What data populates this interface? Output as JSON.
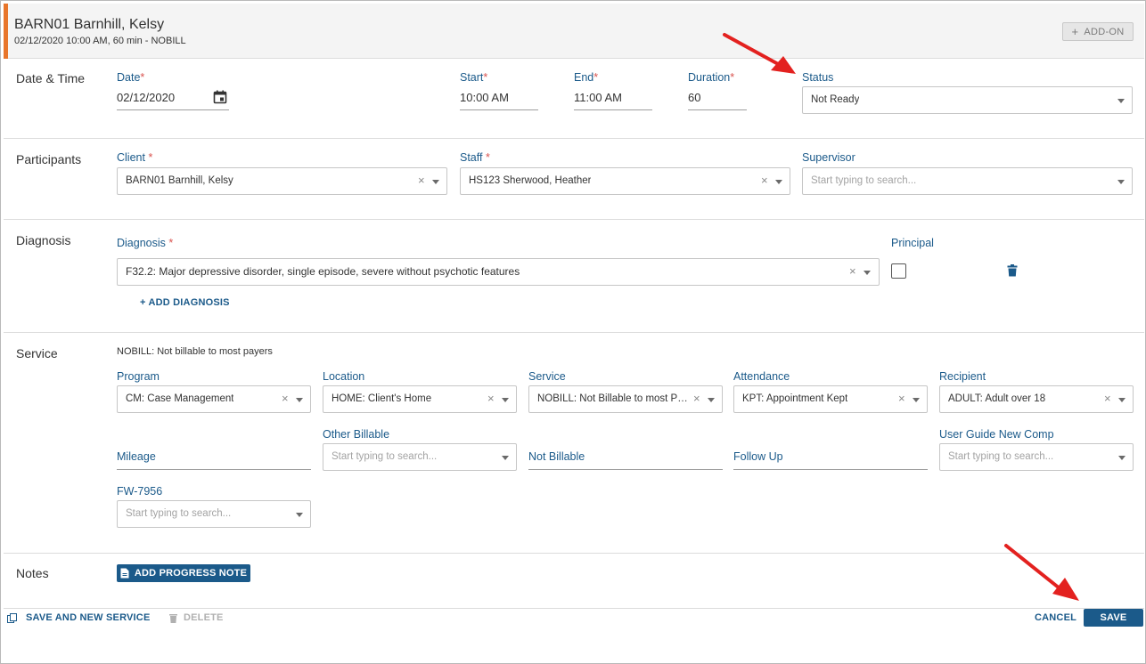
{
  "header": {
    "title": "BARN01 Barnhill, Kelsy",
    "subtitle": "02/12/2020 10:00 AM, 60 min - NOBILL",
    "addon_label": "ADD-ON",
    "accent_color": "#e8752a"
  },
  "sections": {
    "date_time": "Date & Time",
    "participants": "Participants",
    "diagnosis": "Diagnosis",
    "service": "Service",
    "notes": "Notes"
  },
  "date_time": {
    "date_label": "Date",
    "date_value": "02/12/2020",
    "start_label": "Start",
    "start_value": "10:00 AM",
    "end_label": "End",
    "end_value": "11:00 AM",
    "duration_label": "Duration",
    "duration_value": "60",
    "status_label": "Status",
    "status_value": "Not Ready",
    "required_mark": "*"
  },
  "participants": {
    "client_label": "Client",
    "client_value": "BARN01 Barnhill, Kelsy",
    "staff_label": "Staff",
    "staff_value": "HS123 Sherwood, Heather",
    "supervisor_label": "Supervisor",
    "supervisor_placeholder": "Start typing to search..."
  },
  "diagnosis": {
    "diagnosis_label": "Diagnosis",
    "diagnosis_value": "F32.2: Major depressive disorder, single episode, severe without psychotic features",
    "principal_label": "Principal",
    "add_diagnosis": "+ ADD DIAGNOSIS"
  },
  "service": {
    "note": "NOBILL: Not billable to most payers",
    "program_label": "Program",
    "program_value": "CM: Case Management",
    "location_label": "Location",
    "location_value": "HOME: Client's Home",
    "service_label": "Service",
    "service_value": "NOBILL: Not Billable to most Pa...",
    "attendance_label": "Attendance",
    "attendance_value": "KPT: Appointment Kept",
    "recipient_label": "Recipient",
    "recipient_value": "ADULT: Adult over 18",
    "mileage_label": "Mileage",
    "other_billable_label": "Other Billable",
    "other_billable_placeholder": "Start typing to search...",
    "not_billable_label": "Not Billable",
    "follow_up_label": "Follow Up",
    "user_guide_label": "User Guide New Comp",
    "user_guide_placeholder": "Start typing to search...",
    "fw_label": "FW-7956",
    "fw_placeholder": "Start typing to search..."
  },
  "notes": {
    "add_progress_note": "ADD PROGRESS NOTE"
  },
  "footer": {
    "save_and_new": "SAVE AND NEW SERVICE",
    "delete": "DELETE",
    "cancel": "CANCEL",
    "save": "SAVE"
  },
  "colors": {
    "label_blue": "#1b5a8a",
    "required_red": "#d9534f",
    "annotation_red": "#e3211f"
  }
}
